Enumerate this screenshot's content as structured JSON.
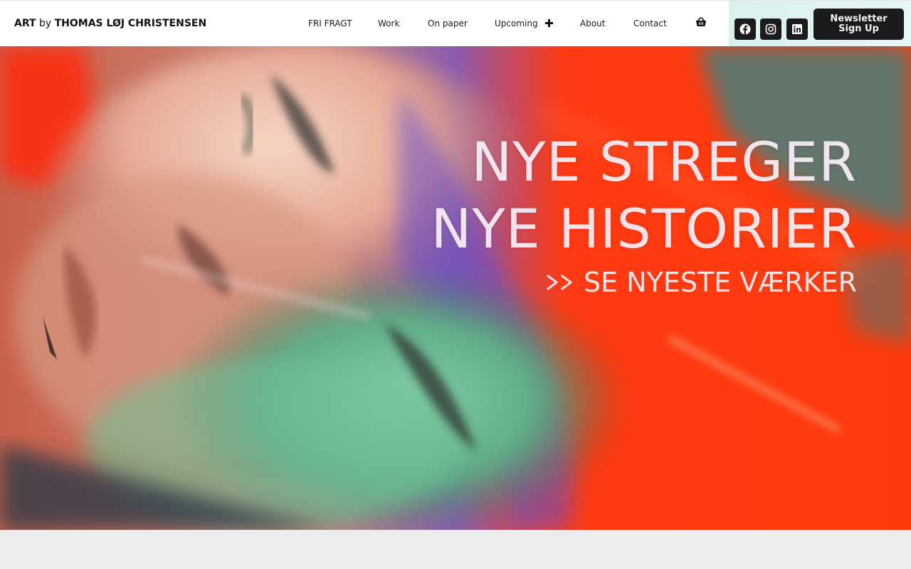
{
  "brand": {
    "part1": "ART",
    "part2": "by",
    "part3": "THOMAS LØJ CHRISTENSEN"
  },
  "nav": {
    "items": [
      {
        "label": "FRI FRAGT"
      },
      {
        "label": "Work"
      },
      {
        "label": "On paper"
      },
      {
        "label": "Upcoming"
      },
      {
        "label": "About"
      },
      {
        "label": "Contact"
      }
    ],
    "basket_icon": "basket-icon"
  },
  "social": {
    "icons": [
      "facebook-icon",
      "instagram-icon",
      "linkedin-icon"
    ],
    "newsletter_label": "Newsletter Sign Up"
  },
  "hero": {
    "line1": "NYE STREGER",
    "line2": "NYE HISTORIER",
    "cta": "SE NYESTE VÆRKER"
  },
  "colors": {
    "header_bg": "#ffffff",
    "social_panel_bg": "#d9f1ee",
    "button_dark": "#1b1b1b",
    "page_bg": "#ececec",
    "hero_red": "#ff3a0a",
    "hero_green": "#5fae86"
  }
}
